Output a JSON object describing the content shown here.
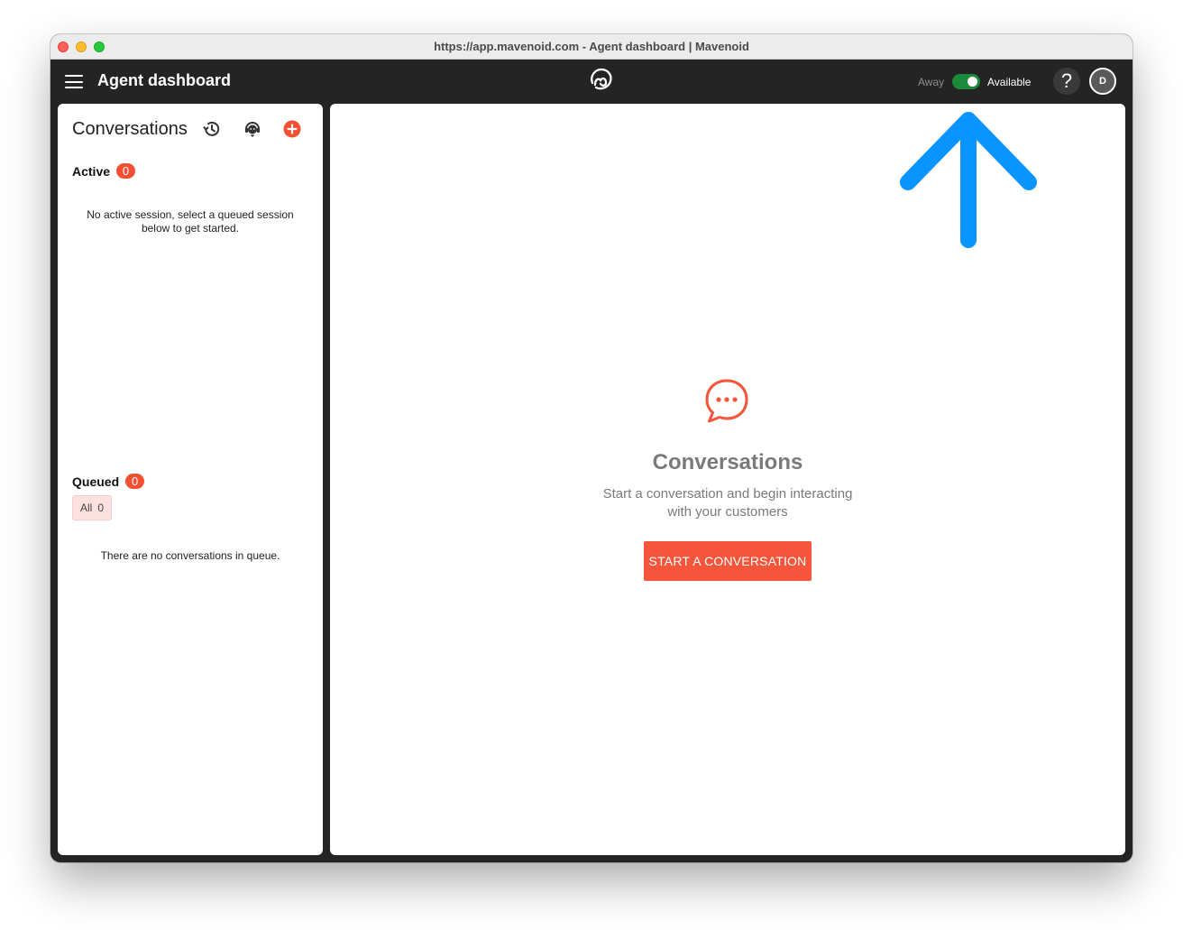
{
  "browser": {
    "window_title": "https://app.mavenoid.com - Agent dashboard | Mavenoid"
  },
  "appbar": {
    "menu_icon": "hamburger-menu-icon",
    "title": "Agent dashboard",
    "logo_icon": "mavenoid-logo-icon",
    "status_off_label": "Away",
    "status_on_label": "Available",
    "status_available": true,
    "help_label": "?",
    "avatar_initial": "D"
  },
  "sidebar": {
    "title": "Conversations",
    "icons": [
      "history-icon",
      "agent-icon",
      "add-icon"
    ],
    "active": {
      "label": "Active",
      "count": "0",
      "empty_text": "No active session, select a queued session below to get started."
    },
    "queued": {
      "label": "Queued",
      "count": "0",
      "filter": {
        "label": "All",
        "count": "0"
      },
      "empty_text": "There are no conversations in queue."
    }
  },
  "main": {
    "icon": "chat-bubble-icon",
    "title": "Conversations",
    "subtitle": "Start a conversation and begin interacting with your customers",
    "cta_label": "START A CONVERSATION"
  },
  "annotation": {
    "icon": "arrow-up-icon"
  },
  "colors": {
    "appbar_bg": "#242424",
    "accent": "#f4553b",
    "toggle_on": "#1b8a3a",
    "annotation_arrow": "#0a94ff"
  }
}
